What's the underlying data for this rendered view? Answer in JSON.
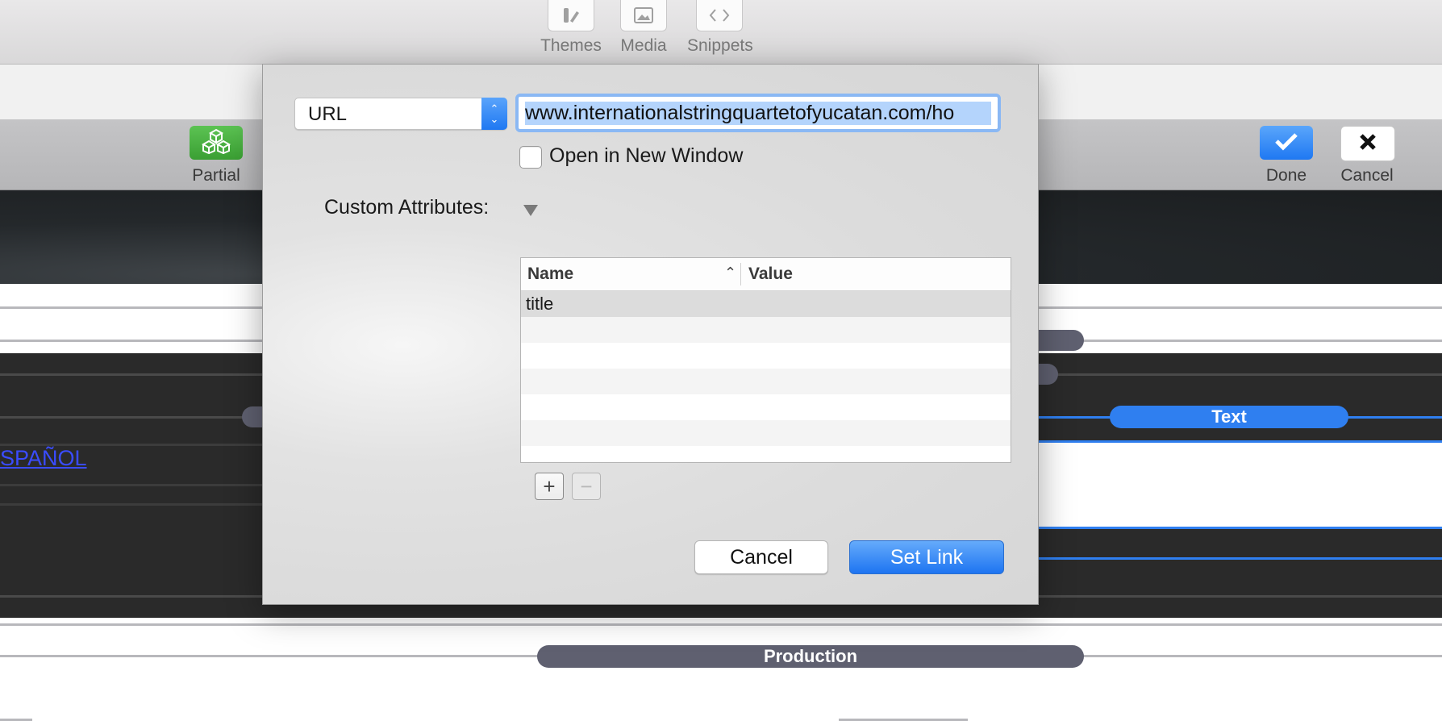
{
  "toolbar": {
    "tools": [
      {
        "label": "Themes",
        "icon": "themes-icon"
      },
      {
        "label": "Media",
        "icon": "media-icon"
      },
      {
        "label": "Snippets",
        "icon": "snippets-icon"
      }
    ]
  },
  "edit_toolbar": {
    "partial_label": "Partial",
    "done_label": "Done",
    "cancel_label": "Cancel"
  },
  "background": {
    "link_text": "SPAÑOL",
    "text_pill": "Text",
    "production_pill": "Production"
  },
  "dialog": {
    "link_type": "URL",
    "url_value": "www.internationalstringquartetofyucatan.com/ho",
    "open_new_window_label": "Open in New Window",
    "open_new_window_checked": false,
    "custom_attributes_label": "Custom Attributes:",
    "table": {
      "columns": [
        "Name",
        "Value"
      ],
      "rows": [
        {
          "name": "title",
          "value": ""
        }
      ]
    },
    "add_symbol": "+",
    "remove_symbol": "−",
    "cancel_label": "Cancel",
    "set_link_label": "Set Link"
  },
  "colors": {
    "accent": "#1f78f2",
    "partial_green": "#46b03e",
    "pill": "#5f6070"
  }
}
